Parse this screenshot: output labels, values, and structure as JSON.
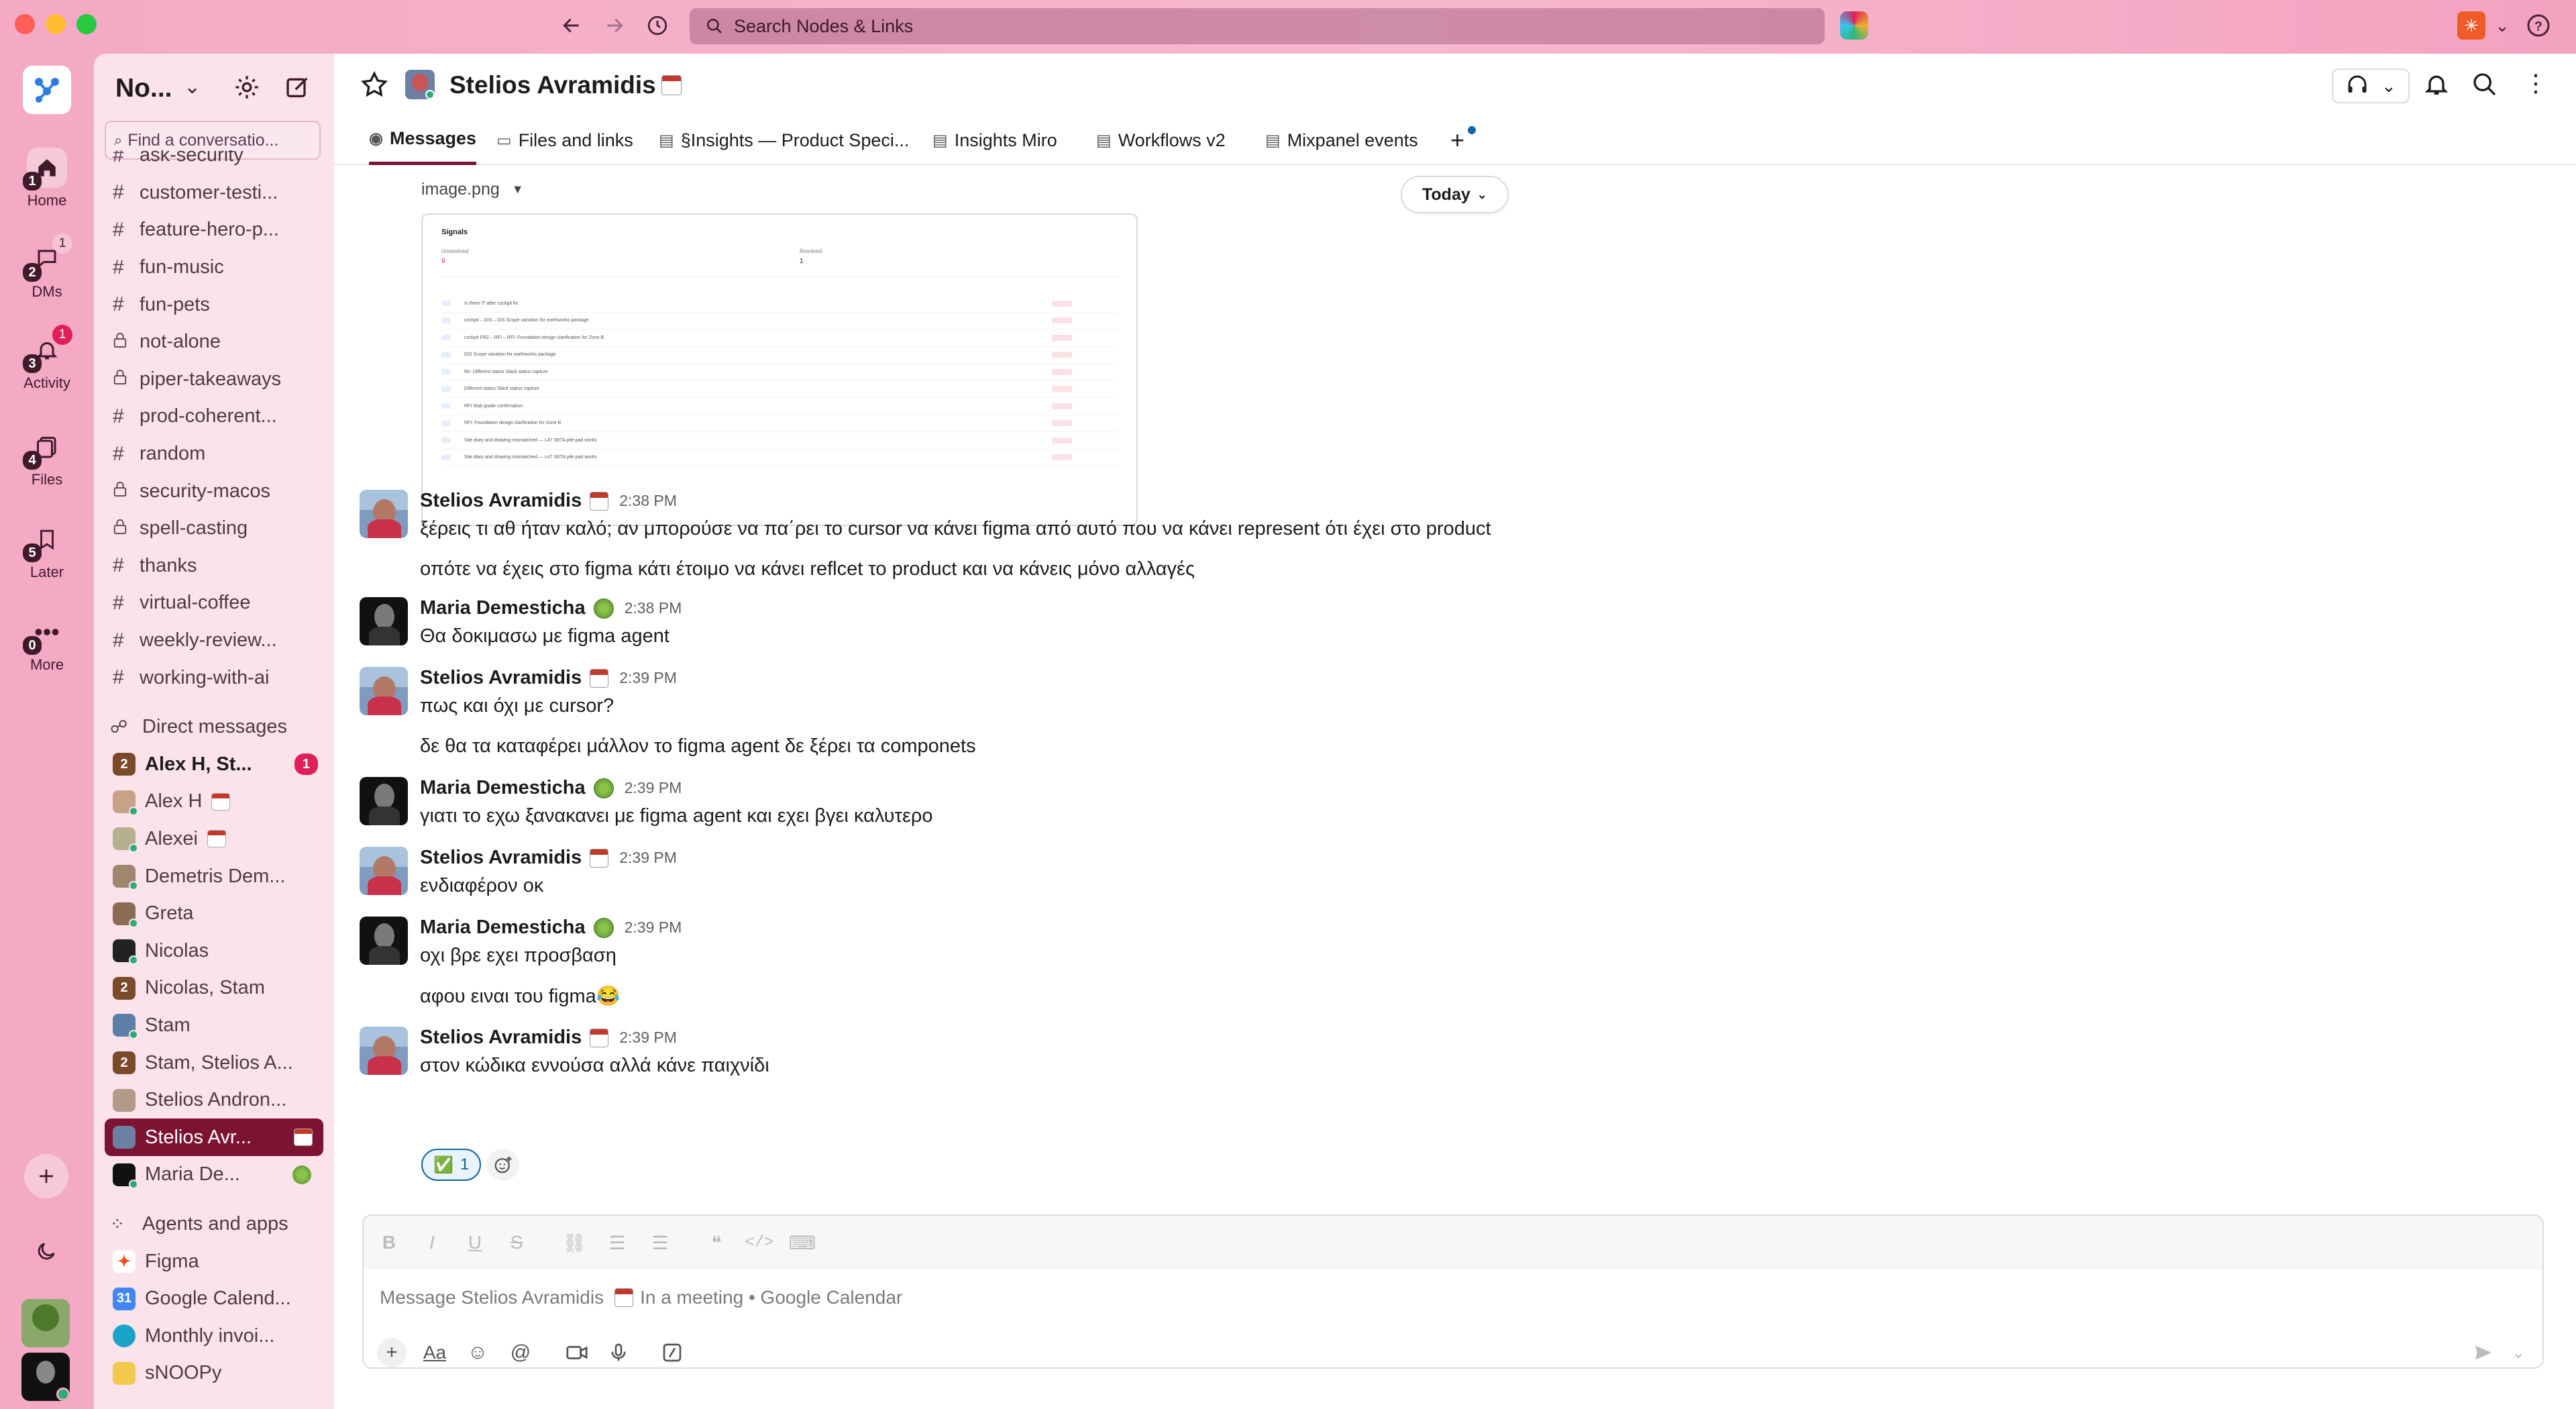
{
  "window": {
    "search_placeholder": "Search Nodes & Links"
  },
  "rail": {
    "items": [
      {
        "label": "Home",
        "count": "1"
      },
      {
        "label": "DMs",
        "count": "2",
        "badge": "1"
      },
      {
        "label": "Activity",
        "count": "3",
        "badge": "1"
      },
      {
        "label": "Files",
        "count": "4"
      },
      {
        "label": "Later",
        "count": "5"
      },
      {
        "label": "More",
        "count": "0"
      }
    ]
  },
  "sidebar": {
    "workspace": "No...",
    "find_placeholder": "Find a conversatio...",
    "channels": [
      {
        "name": "ask-security",
        "icon": "hash"
      },
      {
        "name": "customer-testi...",
        "icon": "hash"
      },
      {
        "name": "feature-hero-p...",
        "icon": "hash"
      },
      {
        "name": "fun-music",
        "icon": "hash"
      },
      {
        "name": "fun-pets",
        "icon": "hash"
      },
      {
        "name": "not-alone",
        "icon": "lock"
      },
      {
        "name": "piper-takeaways",
        "icon": "lock"
      },
      {
        "name": "prod-coherent...",
        "icon": "hash"
      },
      {
        "name": "random",
        "icon": "hash"
      },
      {
        "name": "security-macos",
        "icon": "lock"
      },
      {
        "name": "spell-casting",
        "icon": "lock"
      },
      {
        "name": "thanks",
        "icon": "hash"
      },
      {
        "name": "virtual-coffee",
        "icon": "hash"
      },
      {
        "name": "weekly-review...",
        "icon": "hash"
      },
      {
        "name": "working-with-ai",
        "icon": "hash"
      }
    ],
    "dm_section": "Direct messages",
    "dms": [
      {
        "name": "Alex H, St...",
        "group": "2",
        "unread": "1",
        "bold": true
      },
      {
        "name": "Alex H",
        "status": "calendar"
      },
      {
        "name": "Alexei",
        "status": "calendar"
      },
      {
        "name": "Demetris Dem..."
      },
      {
        "name": "Greta"
      },
      {
        "name": "Nicolas"
      },
      {
        "name": "Nicolas, Stam",
        "group": "2"
      },
      {
        "name": "Stam"
      },
      {
        "name": "Stam, Stelios A...",
        "group": "2"
      },
      {
        "name": "Stelios Andron..."
      },
      {
        "name": "Stelios Avr...",
        "status": "calendar",
        "active": true
      },
      {
        "name": "Maria De...",
        "status": "green"
      }
    ],
    "apps_section": "Agents and apps",
    "apps": [
      {
        "name": "Figma",
        "color": "#f24e1e"
      },
      {
        "name": "Google Calend...",
        "color": "#4285f4"
      },
      {
        "name": "Monthly invoi...",
        "color": "#1aa3c7"
      },
      {
        "name": "sNOOPy",
        "color": "#f2c94c"
      }
    ]
  },
  "header": {
    "title": "Stelios Avramidis"
  },
  "tabs": [
    {
      "label": "Messages",
      "active": true
    },
    {
      "label": "Files and links"
    },
    {
      "label": "§Insights — Product Speci..."
    },
    {
      "label": "Insights Miro"
    },
    {
      "label": "Workflows v2"
    },
    {
      "label": "Mixpanel events"
    }
  ],
  "attachment": {
    "filename": "image.png",
    "date_pill": "Today",
    "preview": {
      "heading": "Signals",
      "stat1_label": "Unresolved",
      "stat1_value": "9",
      "stat2_label": "Resolved",
      "stat2_value": "1",
      "rows": [
        "Is there IT after cockpit fix",
        "cockpit – DIS – DIS Scope variation for earthworks package",
        "cockpit FR2 – RFI – RFI: Foundation design clarification for Zone B",
        "DIS Scope variation for earthworks package",
        "Re: Different status Slack status capture",
        "Different status Slack status capture",
        "RFI Slab grade confirmation",
        "RFI: Foundation design clarification for Zone B",
        "Site diary and drawing mismatched — L47 SETA pile pad works",
        "Site diary and drawing mismatched — L47 SETA pile pad works"
      ]
    }
  },
  "messages": [
    {
      "author": "Stelios Avramidis",
      "status": "calendar",
      "time": "2:38 PM",
      "lines": [
        "ξέρεις τι αθ ήταν καλό; αν μπορούσε να πα΄ρει το cursor να κάνει figma από αυτό που να κάνει represent ότι έχει στο product",
        "οπότε να έχεις στο figma κάτι έτοιμο να κάνει reflcet το product και να κάνεις μόνο αλλαγές"
      ]
    },
    {
      "author": "Maria Demesticha",
      "status": "green",
      "time": "2:38 PM",
      "lines": [
        "Θα δοκιμασω με figma agent"
      ]
    },
    {
      "author": "Stelios Avramidis",
      "status": "calendar",
      "time": "2:39 PM",
      "lines": [
        "πως και όχι με cursor?",
        "δε θα τα καταφέρει μάλλον το figma agent δε ξέρει τα componets"
      ]
    },
    {
      "author": "Maria Demesticha",
      "status": "green",
      "time": "2:39 PM",
      "lines": [
        "γιατι το εχω ξανακανει με figma agent και εχει βγει καλυτερο"
      ]
    },
    {
      "author": "Stelios Avramidis",
      "status": "calendar",
      "time": "2:39 PM",
      "lines": [
        "ενδιαφέρον οκ"
      ]
    },
    {
      "author": "Maria Demesticha",
      "status": "green",
      "time": "2:39 PM",
      "lines": [
        "οχι βρε εχει προσβαση",
        "αφου ειναι του figma😂"
      ]
    },
    {
      "author": "Stelios Avramidis",
      "status": "calendar",
      "time": "2:39 PM",
      "lines": [
        "στον κώδικα εννούσα αλλά κάνε παιχνίδι"
      ]
    }
  ],
  "reaction": {
    "emoji": "✅",
    "count": "1"
  },
  "composer": {
    "placeholder": "Message Stelios Avramidis",
    "status_text": "In a meeting • Google Calendar"
  },
  "colors": {
    "brand": "#7c1332",
    "unread": "#e01e5a",
    "online": "#2bac76"
  }
}
